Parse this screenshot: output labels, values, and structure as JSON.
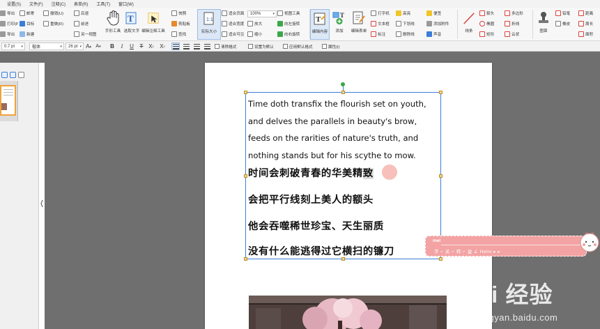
{
  "menu": [
    "设置(S)",
    "文件(F)",
    "注释(C)",
    "表单(R)",
    "工具(T)",
    "窗口(W)"
  ],
  "ribbon": {
    "col1": [
      "导出",
      "打印(P)",
      "导出"
    ],
    "col2": [
      "邮寄",
      "目标",
      "新建"
    ],
    "col3": [
      "撤销(U)",
      "重做(R)",
      ""
    ],
    "col4": [
      "后退",
      "前进",
      "另一视图"
    ],
    "hand_tool": "手形工具",
    "select_text": "选取文字",
    "edit_annotation": "编辑注释工具",
    "col5": [
      "快照",
      "剪贴板",
      "查找"
    ],
    "actual_size": "实际大小",
    "col6": [
      "适合页面",
      "适合宽度",
      "适合可见"
    ],
    "zoom_value": "100%",
    "col7": [
      "",
      "放大",
      "缩小"
    ],
    "col8": [
      "视图工具",
      "向左旋转",
      "向右旋转"
    ],
    "edit_content": "编辑内容",
    "add": "添加",
    "edit_form": "编辑表单",
    "col9": [
      "打字机",
      "文本框",
      "标注"
    ],
    "col10": [
      "高亮",
      "下划线",
      "删除线"
    ],
    "col11": [
      "便签",
      "添加附件",
      "声音"
    ],
    "line": "线条",
    "col12": [
      "箭头",
      "椭圆",
      "矩形"
    ],
    "col13": [
      "多边形",
      "折线",
      "云状"
    ],
    "stamp": "图章",
    "col14": [
      "铅笔",
      "橡皮",
      ""
    ],
    "col15": [
      "距离",
      "周长",
      "面积"
    ]
  },
  "formatbar": {
    "line_width": "0.7 pt",
    "font": "楷体",
    "font_size": "26 pt",
    "grow_font": "A",
    "shrink_font": "A",
    "bold": "B",
    "italic": "I",
    "underline": "U",
    "strike": "T",
    "superscript": "X",
    "subscript": "X",
    "remove_format": "清除格式",
    "set_default": "设置为默认",
    "apply_default": "应用默认格式",
    "properties": "属性(I)"
  },
  "document": {
    "english_text": "Time doth transfix the flourish set on youth, and delves the parallels in beauty's brow, feeds on the rarities of nature's truth, and nothing stands but for his scythe to mow.",
    "cn_line1_prefix": "时间会刺破青春的华美精",
    "cn_line1_highlight": "致",
    "cn_line2": "会把平行线刻上美人的额头",
    "cn_line3": "他会吞噬稀世珍宝、天生丽质",
    "cn_line4": "没有什么能逃得过它横扫的镰刀"
  },
  "comment": {
    "author": "mei",
    "content": "字 ⌐ 关 ⌐ 转 ⌐ 益 ∠ Hello ▸ ▸"
  },
  "watermark": {
    "brand": "Bai 经验",
    "url": "jingyan.baidu.com"
  }
}
